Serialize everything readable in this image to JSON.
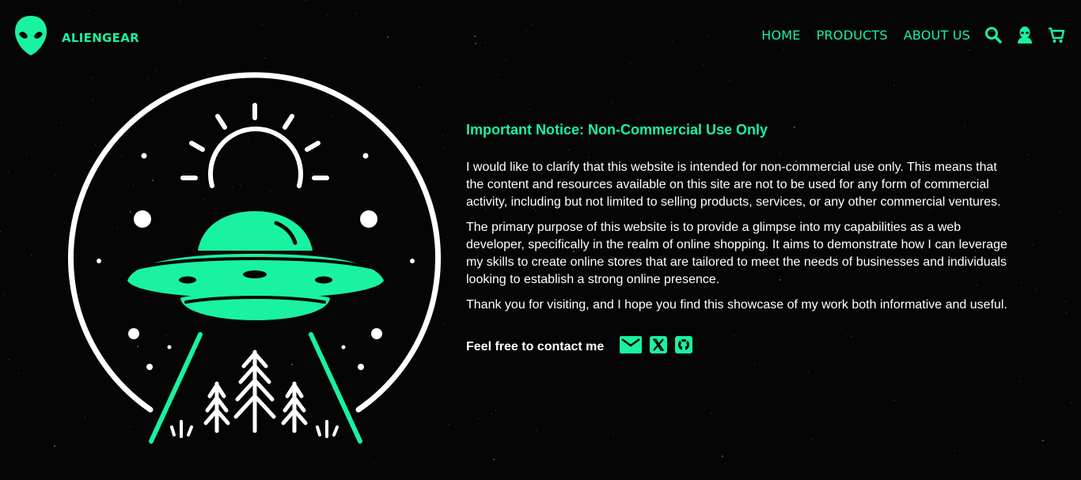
{
  "brand": {
    "name": "ALIENGEAR",
    "logo_icon": "alien-head-icon"
  },
  "nav": {
    "items": [
      "HOME",
      "PRODUCTS",
      "ABOUT US"
    ],
    "icons": [
      "search-icon",
      "alien-user-icon",
      "cart-icon"
    ]
  },
  "notice": {
    "title": "Important Notice: Non-Commercial Use Only",
    "paragraphs": [
      "I would like to clarify that this website is intended for non-commercial use only. This means that the content and resources available on this site are not to be used for any form of commercial activity, including but not limited to selling products, services, or any other commercial ventures.",
      "The primary purpose of this website is to provide a glimpse into my capabilities as a web developer, specifically in the realm of online shopping. It aims to demonstrate how I can leverage my skills to create online stores that are tailored to meet the needs of businesses and individuals looking to establish a strong online presence.",
      "Thank you for visiting, and I hope you find this showcase of my work both informative and useful."
    ]
  },
  "contact": {
    "label": "Feel free to contact me",
    "icons": [
      "email-icon",
      "x-icon",
      "github-icon"
    ]
  },
  "colors": {
    "accent": "#19f2a1",
    "background": "#050505",
    "text": "#ffffff"
  }
}
